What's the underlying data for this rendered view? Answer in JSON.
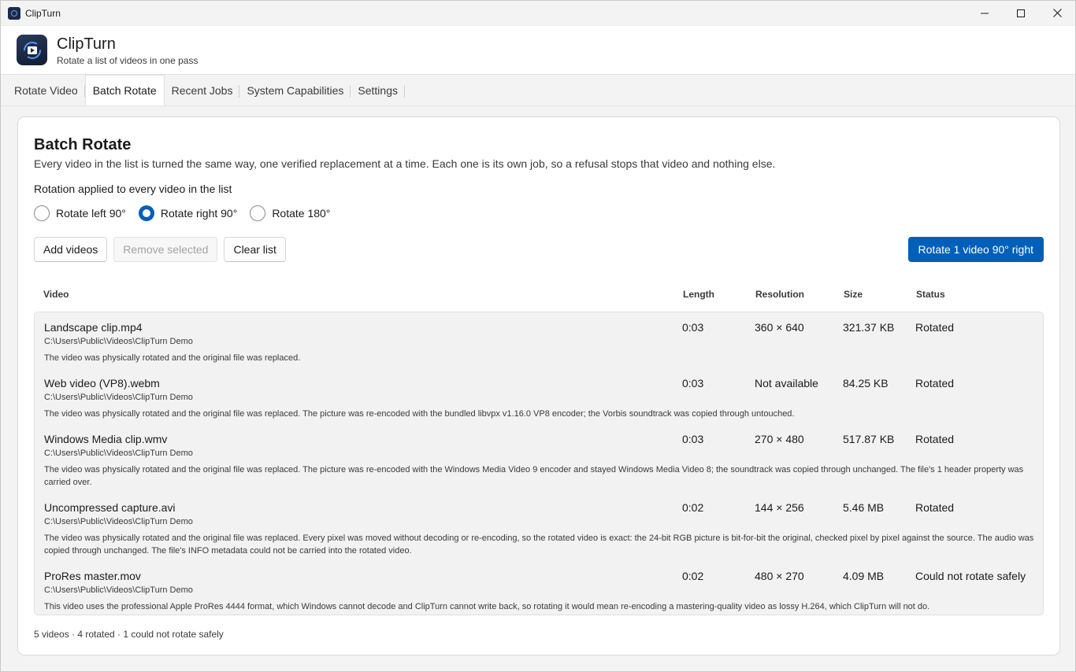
{
  "window": {
    "title": "ClipTurn",
    "controls": [
      "minimize-icon",
      "maximize-icon",
      "close-icon"
    ]
  },
  "header": {
    "app_name": "ClipTurn",
    "tagline": "Rotate a list of videos in one pass"
  },
  "tabs": [
    {
      "label": "Rotate Video",
      "active": false
    },
    {
      "label": "Batch Rotate",
      "active": true
    },
    {
      "label": "Recent Jobs",
      "active": false
    },
    {
      "label": "System Capabilities",
      "active": false
    },
    {
      "label": "Settings",
      "active": false
    }
  ],
  "page": {
    "title": "Batch Rotate",
    "description": "Every video in the list is turned the same way, one verified replacement at a time. Each one is its own job, so a refusal stops that video and nothing else.",
    "rotation_label": "Rotation applied to every video in the list",
    "rotation_options": [
      {
        "label": "Rotate left 90°",
        "checked": false
      },
      {
        "label": "Rotate right 90°",
        "checked": true
      },
      {
        "label": "Rotate 180°",
        "checked": false
      }
    ]
  },
  "toolbar": {
    "add_label": "Add videos",
    "remove_label": "Remove selected",
    "clear_label": "Clear list",
    "rotate_label": "Rotate 1 video 90° right"
  },
  "table": {
    "headers": {
      "video": "Video",
      "length": "Length",
      "resolution": "Resolution",
      "size": "Size",
      "status": "Status"
    },
    "rows": [
      {
        "name": "Landscape clip.mp4",
        "path": "C:\\Users\\Public\\Videos\\ClipTurn Demo",
        "note": "The video was physically rotated and the original file was replaced.",
        "length": "0:03",
        "resolution": "360 × 640",
        "size": "321.37 KB",
        "status": "Rotated"
      },
      {
        "name": "Web video (VP8).webm",
        "path": "C:\\Users\\Public\\Videos\\ClipTurn Demo",
        "note": "The video was physically rotated and the original file was replaced. The picture was re-encoded with the bundled libvpx v1.16.0 VP8 encoder; the Vorbis soundtrack was copied through untouched.",
        "length": "0:03",
        "resolution": "Not available",
        "size": "84.25 KB",
        "status": "Rotated"
      },
      {
        "name": "Windows Media clip.wmv",
        "path": "C:\\Users\\Public\\Videos\\ClipTurn Demo",
        "note": "The video was physically rotated and the original file was replaced. The picture was re-encoded with the Windows Media Video 9 encoder and stayed Windows Media Video 8; the soundtrack was copied through unchanged. The file's 1 header property was carried over.",
        "length": "0:03",
        "resolution": "270 × 480",
        "size": "517.87 KB",
        "status": "Rotated"
      },
      {
        "name": "Uncompressed capture.avi",
        "path": "C:\\Users\\Public\\Videos\\ClipTurn Demo",
        "note": "The video was physically rotated and the original file was replaced. Every pixel was moved without decoding or re-encoding, so the rotated video is exact: the 24-bit RGB picture is bit-for-bit the original, checked pixel by pixel against the source. The audio was copied through unchanged. The file's INFO metadata could not be carried into the rotated video.",
        "length": "0:02",
        "resolution": "144 × 256",
        "size": "5.46 MB",
        "status": "Rotated"
      },
      {
        "name": "ProRes master.mov",
        "path": "C:\\Users\\Public\\Videos\\ClipTurn Demo",
        "note": "This video uses the professional Apple ProRes 4444 format, which Windows cannot decode and ClipTurn cannot write back, so rotating it would mean re-encoding a mastering-quality video as lossy H.264, which ClipTurn will not do.",
        "length": "0:02",
        "resolution": "480 × 270",
        "size": "4.09 MB",
        "status": "Could not rotate safely"
      }
    ]
  },
  "footer": {
    "summary": "5 videos · 4 rotated · 1 could not rotate safely"
  },
  "colors": {
    "accent": "#005fb8",
    "background": "#f3f3f3",
    "card": "#ffffff",
    "list_background": "#f2f2f2"
  }
}
